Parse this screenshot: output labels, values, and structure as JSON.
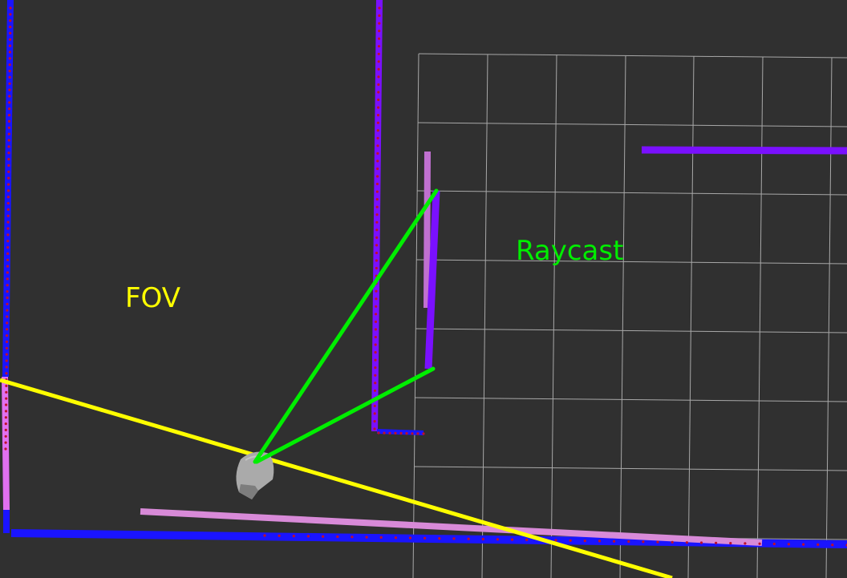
{
  "viewport": {
    "background_color": "#303030",
    "grid_color": "#a8a8a8"
  },
  "labels": {
    "fov": "FOV",
    "raycast": "Raycast"
  },
  "colors": {
    "fov_line": "#ffff00",
    "raycast_line": "#00ee00",
    "wall_blue": "#1a14ff",
    "wall_violet": "#7a10ff",
    "wall_pink": "#d88ad8",
    "scan_points": "#c0102a",
    "robot": "#aaaaaa"
  },
  "icons": {
    "robot": "robot-model-icon"
  }
}
